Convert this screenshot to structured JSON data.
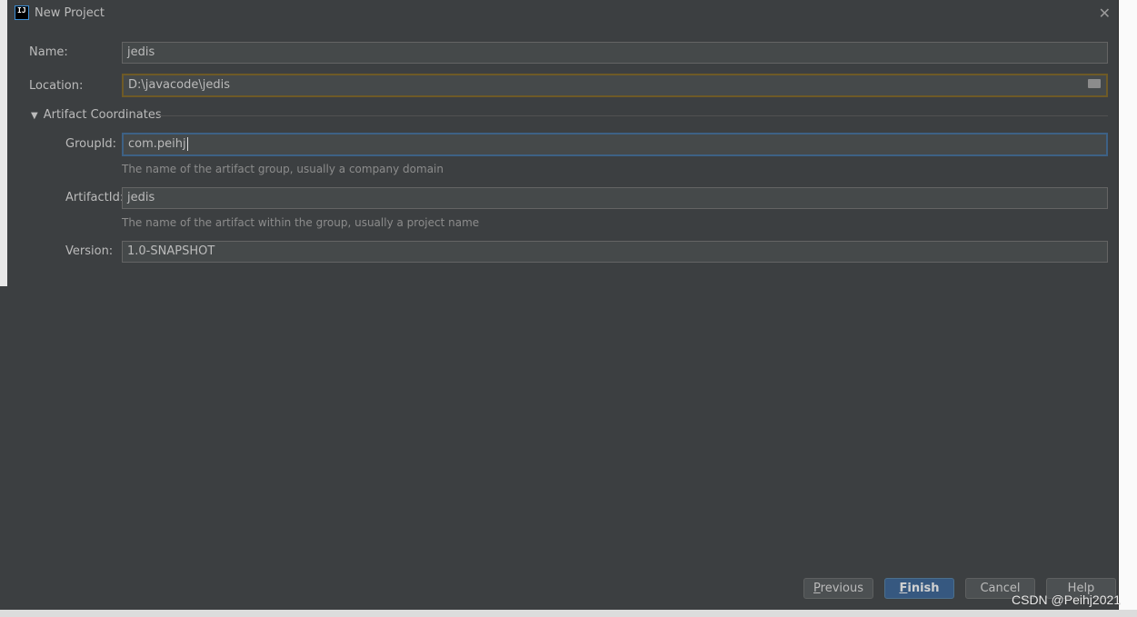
{
  "dialog": {
    "title": "New Project",
    "name_label": "Name:",
    "name_value": "jedis",
    "location_label": "Location:",
    "location_value": "D:\\javacode\\jedis",
    "section_title": "Artifact Coordinates",
    "groupid_label": "GroupId:",
    "groupid_value": "com.peihj",
    "groupid_hint": "The name of the artifact group, usually a company domain",
    "artifactid_label": "ArtifactId:",
    "artifactid_value": "jedis",
    "artifactid_hint": "The name of the artifact within the group, usually a project name",
    "version_label": "Version:",
    "version_value": "1.0-SNAPSHOT"
  },
  "buttons": {
    "previous_mnemonic": "P",
    "previous_rest": "revious",
    "finish_mnemonic": "F",
    "finish_rest": "inish",
    "cancel": "Cancel",
    "help": "Help"
  },
  "watermark": "CSDN @Peihj2021",
  "colors": {
    "dialog_bg": "#3c3f41",
    "primary_button": "#365880",
    "focus_border": "#3d6185"
  }
}
